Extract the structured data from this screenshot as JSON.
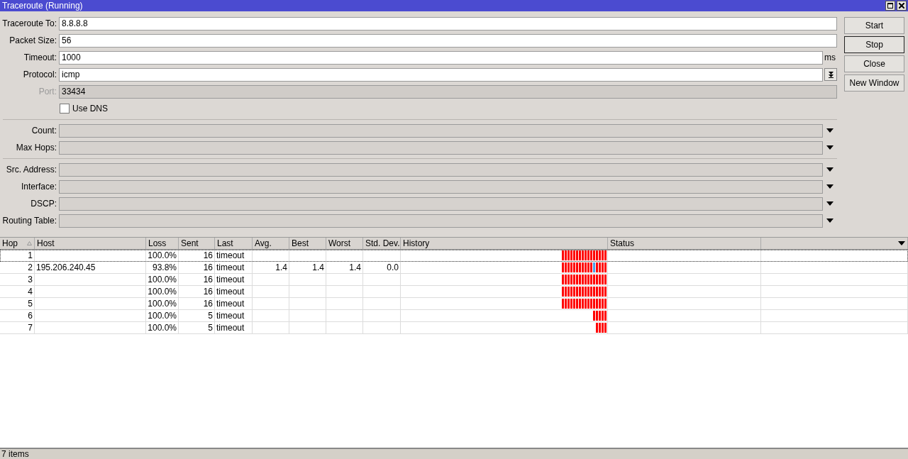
{
  "window": {
    "title": "Traceroute (Running)"
  },
  "sections": [
    [
      {
        "kind": "text",
        "label": "Traceroute To:",
        "value": "8.8.8.8",
        "disabled": false
      },
      {
        "kind": "text",
        "label": "Packet Size:",
        "value": "56",
        "disabled": false
      },
      {
        "kind": "unit",
        "label": "Timeout:",
        "value": "1000",
        "unit": "ms",
        "disabled": false
      },
      {
        "kind": "combo",
        "label": "Protocol:",
        "value": "icmp",
        "disabled": false
      },
      {
        "kind": "text",
        "label": "Port:",
        "value": "33434",
        "disabled": true
      },
      {
        "kind": "checkbox",
        "label": "Use DNS",
        "checked": false
      }
    ],
    [
      {
        "kind": "dropdown",
        "label": "Count:"
      },
      {
        "kind": "dropdown",
        "label": "Max Hops:"
      }
    ],
    [
      {
        "kind": "dropdown",
        "label": "Src. Address:"
      },
      {
        "kind": "dropdown",
        "label": "Interface:"
      },
      {
        "kind": "dropdown",
        "label": "DSCP:"
      },
      {
        "kind": "dropdown",
        "label": "Routing Table:"
      }
    ]
  ],
  "buttons": [
    {
      "label": "Start",
      "default": false
    },
    {
      "label": "Stop",
      "default": true
    },
    {
      "label": "Close",
      "default": false
    },
    {
      "label": "New Window",
      "default": false
    }
  ],
  "table": {
    "columns": [
      "Hop",
      "Host",
      "Loss",
      "Sent",
      "Last",
      "Avg.",
      "Best",
      "Worst",
      "Std. Dev.",
      "History",
      "Status"
    ],
    "rows": [
      {
        "selected": true,
        "cells": [
          "1",
          "",
          "100.0%",
          "16",
          "timeout",
          "",
          "",
          "",
          "",
          ""
        ],
        "history_lost": [
          true,
          true,
          true,
          true,
          true,
          true,
          true,
          true,
          true,
          true,
          true,
          true,
          true,
          true,
          true,
          true
        ]
      },
      {
        "selected": false,
        "cells": [
          "2",
          "195.206.240.45",
          "93.8%",
          "16",
          "timeout",
          "1.4",
          "1.4",
          "1.4",
          "0.0",
          ""
        ],
        "history_lost": [
          true,
          true,
          true,
          true,
          true,
          true,
          true,
          true,
          true,
          true,
          true,
          false,
          true,
          true,
          true,
          true
        ]
      },
      {
        "selected": false,
        "cells": [
          "3",
          "",
          "100.0%",
          "16",
          "timeout",
          "",
          "",
          "",
          "",
          ""
        ],
        "history_lost": [
          true,
          true,
          true,
          true,
          true,
          true,
          true,
          true,
          true,
          true,
          true,
          true,
          true,
          true,
          true,
          true
        ]
      },
      {
        "selected": false,
        "cells": [
          "4",
          "",
          "100.0%",
          "16",
          "timeout",
          "",
          "",
          "",
          "",
          ""
        ],
        "history_lost": [
          true,
          true,
          true,
          true,
          true,
          true,
          true,
          true,
          true,
          true,
          true,
          true,
          true,
          true,
          true,
          true
        ]
      },
      {
        "selected": false,
        "cells": [
          "5",
          "",
          "100.0%",
          "16",
          "timeout",
          "",
          "",
          "",
          "",
          ""
        ],
        "history_lost": [
          true,
          true,
          true,
          true,
          true,
          true,
          true,
          true,
          true,
          true,
          true,
          true,
          true,
          true,
          true,
          true
        ]
      },
      {
        "selected": false,
        "cells": [
          "6",
          "",
          "100.0%",
          "5",
          "timeout",
          "",
          "",
          "",
          "",
          ""
        ],
        "history_lost": [
          true,
          true,
          true,
          true,
          true
        ]
      },
      {
        "selected": false,
        "cells": [
          "7",
          "",
          "100.0%",
          "5",
          "timeout",
          "",
          "",
          "",
          "",
          ""
        ],
        "history_lost": [
          true,
          true,
          true,
          true
        ]
      }
    ]
  },
  "status_bar": "7 items"
}
